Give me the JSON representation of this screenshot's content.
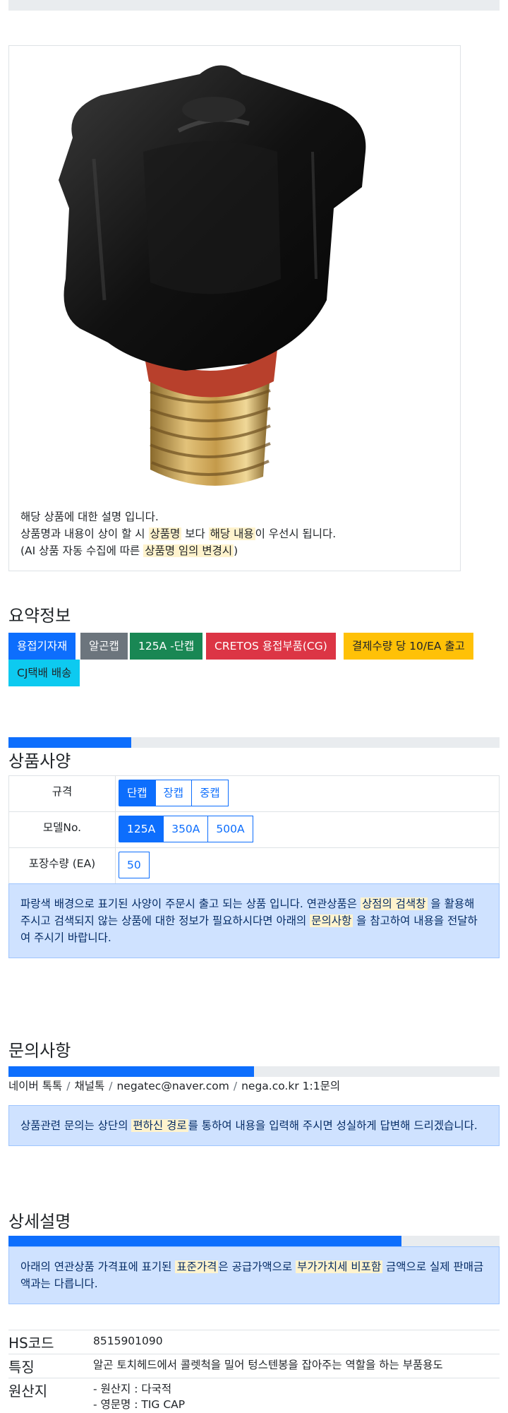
{
  "product_image_alt": "TIG torch back cap",
  "notes": {
    "line1": "해당 상품에 대한 설명 입니다.",
    "line2_a": "상품명과 내용이 상이 할 시 ",
    "line2_b": "상품명",
    "line2_c": " 보다 ",
    "line2_d": "해당 내용",
    "line2_e": "이 우선시 됩니다.",
    "line3_a": "(AI 상품 자동 수집에 따른 ",
    "line3_b": "상품명 임의 변경시",
    "line3_c": ")"
  },
  "summary": {
    "title": "요약정보",
    "badges": [
      {
        "label": "용접기자재",
        "color": "#0d6efd"
      },
      {
        "label": "알곤캡",
        "color": "#6c757d"
      },
      {
        "label": "125A -단캡",
        "color": "#198754"
      },
      {
        "label": "CRETOS 용접부품(CG)",
        "color": "#dc3545"
      },
      {
        "label": "결제수량 당 10/EA 출고",
        "color": "#ffc107"
      },
      {
        "label": "CJ택배 배송",
        "color": "#0dcaf0"
      }
    ]
  },
  "spec": {
    "progress": 0.25,
    "title": "상품사양",
    "rows": [
      {
        "label": "규격",
        "options": [
          "단캡",
          "장캡",
          "중캡"
        ],
        "selected": 0
      },
      {
        "label": "모델No.",
        "options": [
          "125A",
          "350A",
          "500A"
        ],
        "selected": 0
      },
      {
        "label": "포장수량 (EA)",
        "options": [
          "50"
        ],
        "selected": -1
      }
    ],
    "alert_a": "파랑색 배경으로 표기된 사양이 주문시 출고 되는 상품 입니다. 연관상품은 ",
    "alert_b": "상점의 검색창",
    "alert_c": " 을 활용해 주시고 검색되지 않는 상품에 대한 정보가 필요하시다면 아래의 ",
    "alert_d": "문의사항",
    "alert_e": " 을 참고하여 내용을 전달하여 주시기 바랍니다."
  },
  "inquiry": {
    "title": "문의사항",
    "progress": 0.5,
    "links": [
      "네이버 톡톡",
      "채널톡",
      "negatec@naver.com",
      "nega.co.kr 1:1문의"
    ],
    "alert_a": "상품관련 문의는 상단의 ",
    "alert_b": "편하신 경로",
    "alert_c": "를 통하여 내용을 입력해 주시면 성실하게 답변해 드리겠습니다."
  },
  "detail": {
    "title": "상세설명",
    "progress": 0.8,
    "alert_a": "아래의 연관상품 가격표에 표기된 ",
    "alert_b": "표준가격",
    "alert_c": "은 공급가액으로 ",
    "alert_d": "부가가치세 비포함",
    "alert_e": " 금액으로 실제 판매금액과는 다릅니다.",
    "rows": [
      {
        "key": "HS코드",
        "value": "8515901090"
      },
      {
        "key": "특징",
        "value": "알곤 토치헤드에서 콜렛척을 밀어 텅스텐봉을 잡아주는 역할을 하는 부품용도"
      },
      {
        "key": "원산지",
        "value": "- 원산지 : 다국적",
        "value2": "- 영문명 : TIG CAP"
      }
    ]
  }
}
